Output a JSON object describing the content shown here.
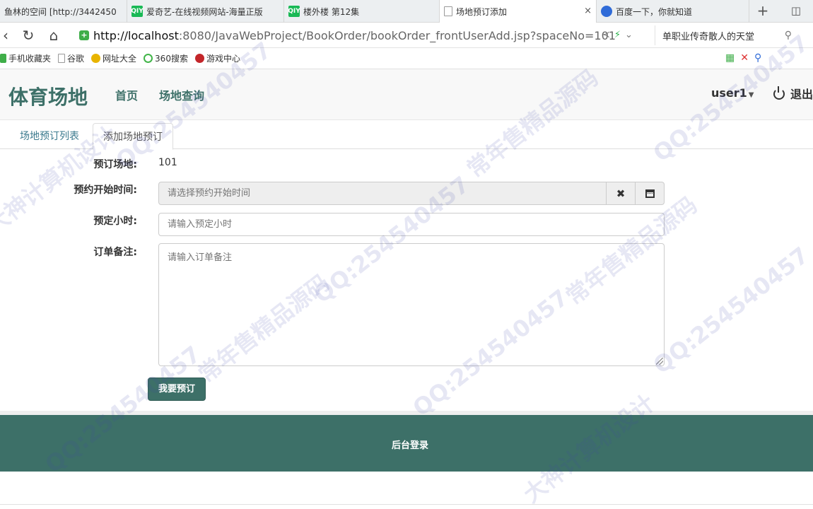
{
  "browser": {
    "tabs": [
      {
        "title": "鱼林的空间 [http://3442450",
        "icon": "page-icon"
      },
      {
        "title": "爱奇艺-在线视频网站-海量正版",
        "icon": "iqiyi-icon"
      },
      {
        "title": "楼外楼 第12集",
        "icon": "iqiyi-icon"
      },
      {
        "title": "场地预订添加",
        "icon": "page-icon",
        "active": true
      },
      {
        "title": "百度一下，你就知道",
        "icon": "baidu-icon"
      }
    ],
    "tab_icon_text": "QIY",
    "new_tab_glyph": "+",
    "close_glyph": "×",
    "url_host": "http://localhost",
    "url_rest": ":8080/JavaWebProject/BookOrder/bookOrder_frontUserAdd.jsp?spaceNo=101",
    "search_text": "单职业传奇散人的天堂",
    "bookmarks": [
      {
        "label": "手机收藏夹",
        "color": "#3fae49"
      },
      {
        "label": "谷歌",
        "color": "#9e9e9e"
      },
      {
        "label": "网址大全",
        "color": "#e8b400"
      },
      {
        "label": "360搜索",
        "color": "#42b549"
      },
      {
        "label": "游戏中心",
        "color": "#c3262a"
      }
    ]
  },
  "app": {
    "brand": "体育场地",
    "nav": {
      "home": "首页",
      "space_query": "场地查询"
    },
    "user": "user1",
    "logout": "退出",
    "tabs": {
      "list": "场地预订列表",
      "add": "添加场地预订"
    },
    "form": {
      "space_label": "预订场地:",
      "space_value": "101",
      "start_time_label": "预约开始时间:",
      "start_time_placeholder": "请选择预约开始时间",
      "clear_glyph": "✖",
      "hours_label": "预定小时:",
      "hours_placeholder": "请输入预定小时",
      "memo_label": "订单备注:",
      "memo_placeholder": "请输入订单备注",
      "submit": "我要预订"
    },
    "footer": {
      "admin_login": "后台登录"
    }
  },
  "colors": {
    "brand": "#3d7068",
    "link": "#3b7a8e"
  }
}
